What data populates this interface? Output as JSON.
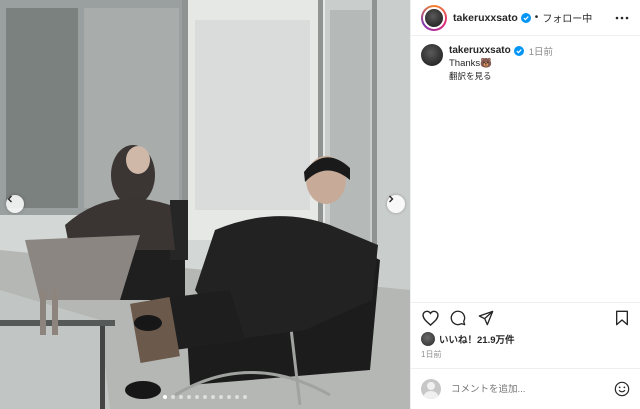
{
  "post": {
    "username": "takeruxxsato",
    "follow_label": "フォロー中",
    "separator": "•",
    "caption": {
      "username": "takeruxxsato",
      "time": "1日前",
      "text": "Thanks🐻",
      "translate_label": "翻訳を見る"
    },
    "likes_label": "いいね！21.9万件",
    "posted_label": "1日前",
    "comment_placeholder": "コメントを追加...",
    "carousel": {
      "total": 11,
      "active_index": 0
    }
  },
  "colors": {
    "text": "#262626",
    "muted": "#8e8e8e",
    "verified": "#0095f6",
    "border": "#efefef"
  },
  "icons": {
    "verified": "verified-badge-icon",
    "more": "more-dots-icon",
    "like": "heart-icon",
    "comment": "comment-icon",
    "share": "send-icon",
    "save": "bookmark-icon",
    "emoji": "emoji-icon",
    "prev": "chevron-left-icon",
    "next": "chevron-right-icon"
  }
}
